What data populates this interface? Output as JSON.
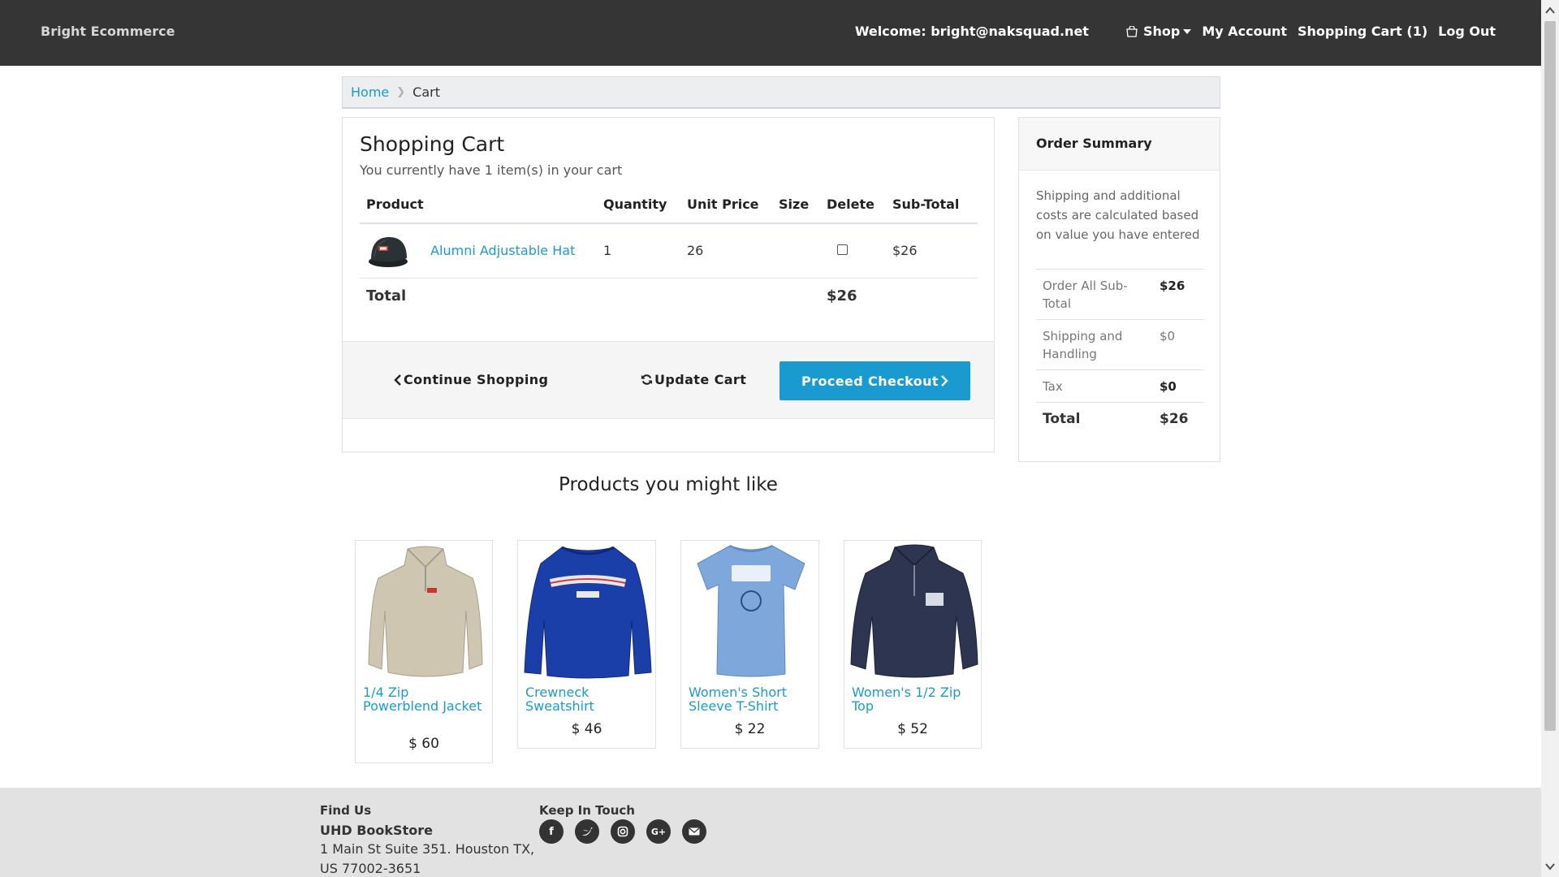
{
  "navbar": {
    "brand": "Bright Ecommerce",
    "welcome": "Welcome: bright@naksquad.net",
    "shop_label": "Shop",
    "account_label": "My Account",
    "cart_label": "Shopping Cart (1)",
    "logout_label": "Log Out"
  },
  "breadcrumb": {
    "home": "Home",
    "current": "Cart"
  },
  "cart": {
    "title": "Shopping Cart",
    "subtitle": "You currently have 1 item(s) in your cart",
    "headers": [
      "Product",
      "Quantity",
      "Unit Price",
      "Size",
      "Delete",
      "Sub-Total"
    ],
    "items": [
      {
        "name": "Alumni Adjustable Hat",
        "quantity": "1",
        "unit_price": "26",
        "size": "",
        "delete_checked": false,
        "subtotal": "$26"
      }
    ],
    "total_label": "Total",
    "total_value": "$26",
    "continue_label": "Continue Shopping",
    "update_label": "Update Cart",
    "checkout_label": "Proceed Checkout"
  },
  "summary": {
    "title": "Order Summary",
    "note": "Shipping and additional costs are calculated based on value you have entered",
    "rows": [
      {
        "label": "Order All Sub-Total",
        "value": "$26"
      },
      {
        "label": "Shipping and Handling",
        "value": "$0"
      },
      {
        "label": "Tax",
        "value": "$0"
      },
      {
        "label": "Total",
        "value": "$26"
      }
    ]
  },
  "recommendations": {
    "title": "Products you might like",
    "items": [
      {
        "name": "1/4 Zip Powerblend Jacket",
        "price": "$ 60"
      },
      {
        "name": "Crewneck Sweatshirt",
        "price": "$ 46"
      },
      {
        "name": "Women's Short Sleeve T-Shirt",
        "price": "$ 22"
      },
      {
        "name": "Women's 1/2 Zip Top",
        "price": "$ 52"
      }
    ]
  },
  "footer": {
    "find_us": "Find Us",
    "store_name": "UHD BookStore",
    "address_line1": "1 Main St Suite 351. Houston TX,",
    "address_line2": "US 77002-3651",
    "keep_in_touch": "Keep In Touch",
    "social_icons": [
      "facebook-icon",
      "twitter-icon",
      "instagram-icon",
      "google-plus-icon",
      "email-icon"
    ]
  },
  "colors": {
    "navbar": "#353535",
    "accent": "#1a9bd0",
    "footer": "#e2e2e2"
  }
}
